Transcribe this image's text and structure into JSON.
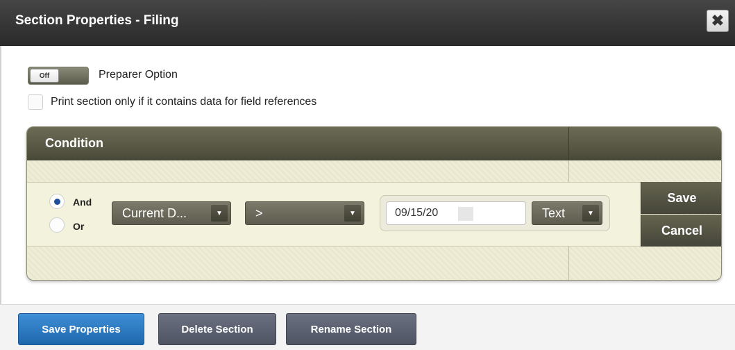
{
  "window": {
    "title": "Section Properties - Filing",
    "close_icon": "close-x-icon"
  },
  "options": {
    "toggle_state": "Off",
    "preparer_label": "Preparer Option",
    "print_only_label": "Print section only if it contains data for field references",
    "print_only_checked": false
  },
  "condition": {
    "header": "Condition",
    "logic": {
      "and_label": "And",
      "or_label": "Or",
      "selected": "And"
    },
    "field_select": "Current D...",
    "operator_select": ">",
    "value": "09/15/20",
    "type_select": "Text",
    "save_label": "Save",
    "cancel_label": "Cancel"
  },
  "footer": {
    "save_properties": "Save Properties",
    "delete_section": "Delete Section",
    "rename_section": "Rename Section"
  },
  "colors": {
    "titlebar": "#333333",
    "panel_header": "#5b5a48",
    "primary_button": "#2b7bc4",
    "dark_button": "#5b6170"
  }
}
